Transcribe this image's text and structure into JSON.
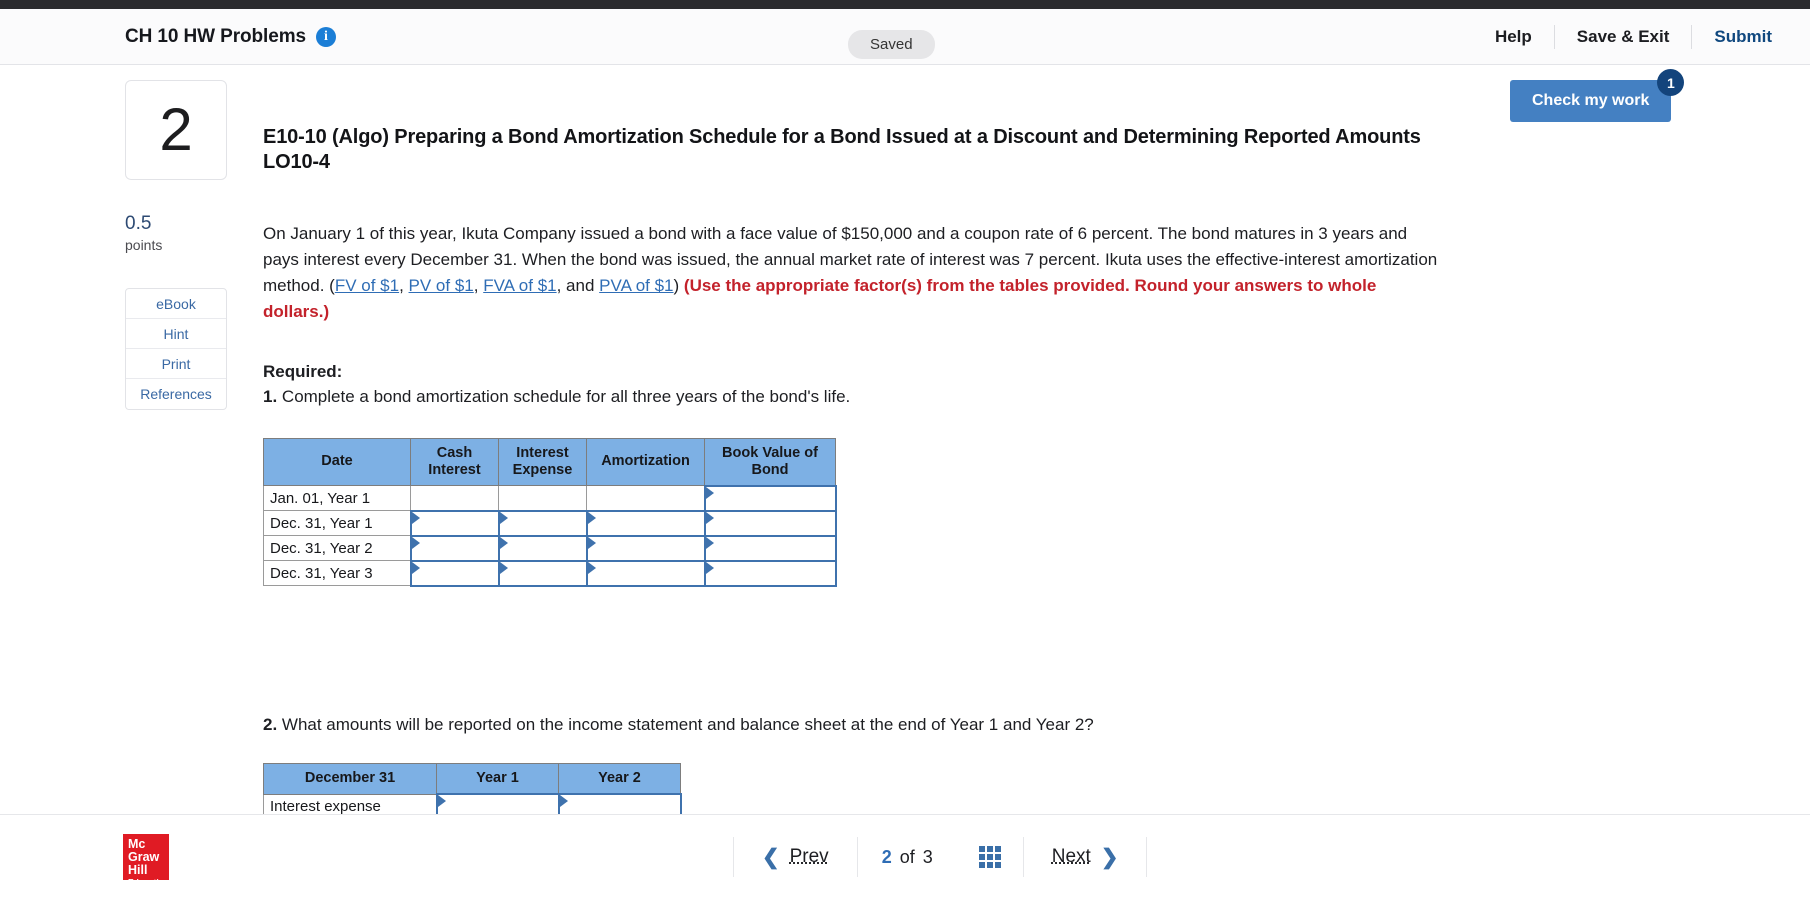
{
  "header": {
    "assignment_title": "CH 10 HW Problems",
    "info_icon": "info-icon",
    "status": "Saved",
    "help_label": "Help",
    "save_exit_label": "Save & Exit",
    "submit_label": "Submit"
  },
  "check_my_work": {
    "label": "Check my work",
    "badge": "1",
    "accent": "#4480c2",
    "badge_color": "#13447c"
  },
  "rail": {
    "question_number": "2",
    "points_value": "0.5",
    "points_label": "points",
    "links": [
      {
        "label": "eBook"
      },
      {
        "label": "Hint"
      },
      {
        "label": "Print"
      },
      {
        "label": "References"
      }
    ]
  },
  "question": {
    "title": "E10-10 (Algo) Preparing a Bond Amortization Schedule for a Bond Issued at a Discount and Determining Reported Amounts LO10-4",
    "body_p1": "On January 1 of this year, Ikuta Company issued a bond with a face value of $150,000 and a coupon rate of 6 percent. The bond matures in 3 years and pays interest every December 31. When the bond was issued, the annual market rate of interest was 7 percent. Ikuta uses the effective-interest amortization method. (",
    "links": [
      {
        "label": "FV of $1"
      },
      {
        "label": "PV of $1"
      },
      {
        "label": "FVA of $1"
      },
      {
        "label": "PVA of $1"
      }
    ],
    "body_sep1": ", ",
    "body_sep2": ", ",
    "body_sep3": ", and ",
    "body_close": ") ",
    "red_note": "(Use the appropriate factor(s) from the tables provided. Round your answers to whole dollars.)",
    "required_header": "Required:",
    "req1_num": "1.",
    "req1_text": " Complete a bond amortization schedule for all three years of the bond's life.",
    "req2_num": "2.",
    "req2_text": " What amounts will be reported on the income statement and balance sheet at the end of Year 1 and Year 2?"
  },
  "table1": {
    "headers": [
      "Date",
      "Cash Interest",
      "Interest Expense",
      "Amortization",
      "Book Value of Bond"
    ],
    "header_lines": [
      [
        "Date"
      ],
      [
        "Cash",
        "Interest"
      ],
      [
        "Interest",
        "Expense"
      ],
      [
        "Amortization"
      ],
      [
        "Book Value of",
        "Bond"
      ]
    ],
    "rows": [
      {
        "date": "Jan. 01, Year 1",
        "cash_interest": "",
        "interest_expense": "",
        "amortization": "",
        "book_value": "",
        "inputs": [
          false,
          false,
          false,
          true
        ]
      },
      {
        "date": "Dec. 31, Year 1",
        "cash_interest": "",
        "interest_expense": "",
        "amortization": "",
        "book_value": "",
        "inputs": [
          true,
          true,
          true,
          true
        ]
      },
      {
        "date": "Dec. 31, Year 2",
        "cash_interest": "",
        "interest_expense": "",
        "amortization": "",
        "book_value": "",
        "inputs": [
          true,
          true,
          true,
          true
        ]
      },
      {
        "date": "Dec. 31, Year 3",
        "cash_interest": "",
        "interest_expense": "",
        "amortization": "",
        "book_value": "",
        "inputs": [
          true,
          true,
          true,
          true
        ]
      }
    ],
    "header_bg": "#7db0e4"
  },
  "table2": {
    "header_lines": [
      [
        "December 31"
      ],
      [
        "Year 1"
      ],
      [
        "Year 2"
      ]
    ],
    "rows": [
      {
        "label": "Interest expense",
        "year1": "",
        "year2": "",
        "inputs": [
          true,
          true
        ]
      }
    ]
  },
  "footer": {
    "logo": {
      "l1": "Mc",
      "l2": "Graw",
      "l3": "Hill",
      "l4": "Education",
      "color": "#e01b24"
    },
    "prev_label": "Prev",
    "next_label": "Next",
    "page_current": "2",
    "page_of": "of",
    "page_total": "3",
    "grid_icon": "grid-icon"
  }
}
